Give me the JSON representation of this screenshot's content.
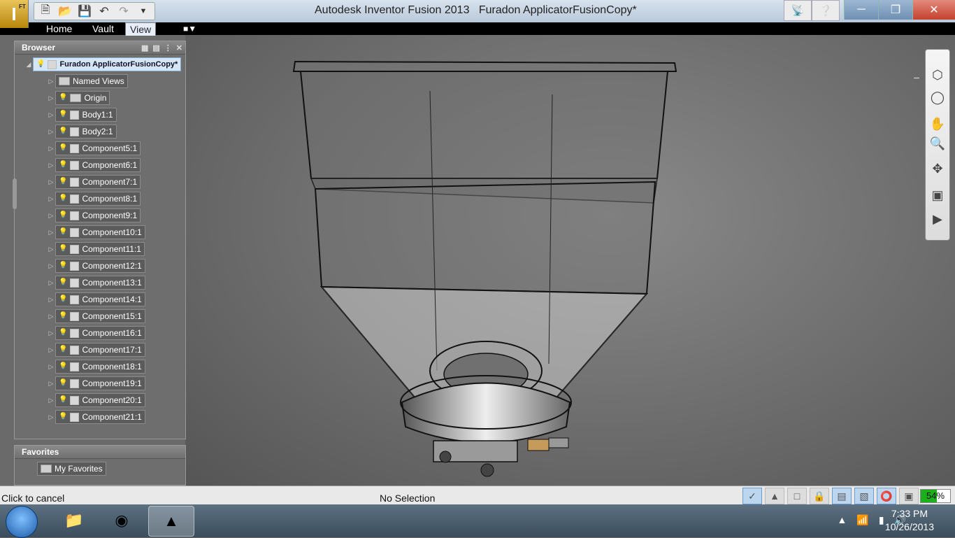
{
  "app": {
    "title": "Autodesk Inventor Fusion 2013",
    "document": "Furadon ApplicatorFusionCopy*",
    "app_button_label": "I",
    "app_button_sub": "FT"
  },
  "ribbon": {
    "tabs": [
      {
        "label": "Home",
        "active": false
      },
      {
        "label": "Vault",
        "active": false
      },
      {
        "label": "View",
        "active": true
      }
    ],
    "extra_icon": "dropdown-arrow"
  },
  "browser": {
    "title": "Browser",
    "root": "Furadon ApplicatorFusionCopy*",
    "items": [
      {
        "label": "Named Views",
        "type": "folder",
        "bulb": false
      },
      {
        "label": "Origin",
        "type": "folder",
        "bulb": true
      },
      {
        "label": "Body1:1",
        "type": "body",
        "bulb": true
      },
      {
        "label": "Body2:1",
        "type": "body",
        "bulb": true
      },
      {
        "label": "Component5:1",
        "type": "component",
        "bulb": true
      },
      {
        "label": "Component6:1",
        "type": "component",
        "bulb": true
      },
      {
        "label": "Component7:1",
        "type": "component",
        "bulb": true
      },
      {
        "label": "Component8:1",
        "type": "component",
        "bulb": true
      },
      {
        "label": "Component9:1",
        "type": "component",
        "bulb": true
      },
      {
        "label": "Component10:1",
        "type": "component",
        "bulb": true
      },
      {
        "label": "Component11:1",
        "type": "component",
        "bulb": true
      },
      {
        "label": "Component12:1",
        "type": "component",
        "bulb": true
      },
      {
        "label": "Component13:1",
        "type": "component",
        "bulb": true
      },
      {
        "label": "Component14:1",
        "type": "component",
        "bulb": true
      },
      {
        "label": "Component15:1",
        "type": "component",
        "bulb": true
      },
      {
        "label": "Component16:1",
        "type": "component",
        "bulb": true
      },
      {
        "label": "Component17:1",
        "type": "component",
        "bulb": true
      },
      {
        "label": "Component18:1",
        "type": "component",
        "bulb": true
      },
      {
        "label": "Component19:1",
        "type": "component",
        "bulb": true
      },
      {
        "label": "Component20:1",
        "type": "component",
        "bulb": true
      },
      {
        "label": "Component21:1",
        "type": "component",
        "bulb": true
      }
    ]
  },
  "favorites": {
    "title": "Favorites",
    "items": [
      {
        "label": "My Favorites"
      }
    ]
  },
  "status": {
    "left": "Click to cancel",
    "center": "No Selection",
    "memory": {
      "label": "54",
      "unit": "%",
      "percent": 54
    }
  },
  "taskbar": {
    "apps": [
      "windows-explorer",
      "google-chrome",
      "autodesk-inventor-fusion"
    ],
    "time": "7:33 PM",
    "date": "10/26/2013"
  },
  "colors": {
    "viewport_bg": "#6d6d6d",
    "root_node_bg": "#d5e6f7",
    "memory_fill": "#1bb01b"
  }
}
